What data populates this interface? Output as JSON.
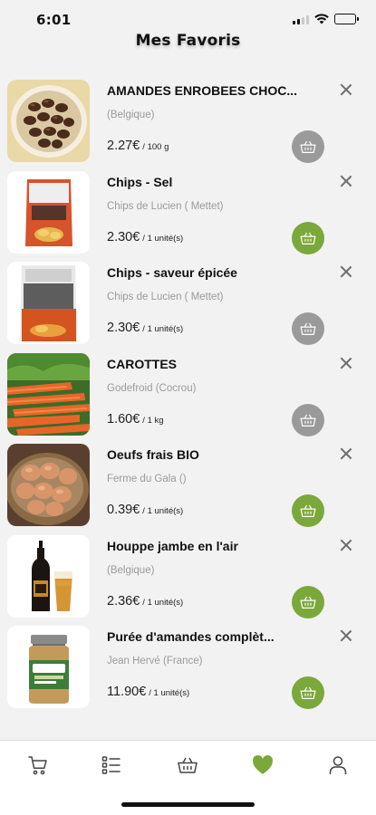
{
  "status_bar": {
    "time": "6:01"
  },
  "header": {
    "title": "Mes Favoris"
  },
  "colors": {
    "accent": "#7ba83a",
    "inactive_button": "#9a9a9a",
    "heart": "#7ba83a"
  },
  "favorites": [
    {
      "name": "AMANDES ENROBEES CHOC...",
      "origin": "(Belgique)",
      "price": "2.27€",
      "unit": "/ 100 g",
      "in_stock": false,
      "image": "chocolate-almonds"
    },
    {
      "name": "Chips - Sel",
      "origin": "Chips de Lucien ( Mettet)",
      "price": "2.30€",
      "unit": "/ 1 unité(s)",
      "in_stock": true,
      "image": "chips-bag"
    },
    {
      "name": "Chips - saveur épicée",
      "origin": "Chips de Lucien ( Mettet)",
      "price": "2.30€",
      "unit": "/ 1 unité(s)",
      "in_stock": false,
      "image": "chips-bag-spicy"
    },
    {
      "name": "CAROTTES",
      "origin": "Godefroid (Cocrou)",
      "price": "1.60€",
      "unit": "/ 1 kg",
      "in_stock": false,
      "image": "carrots"
    },
    {
      "name": "Oeufs frais BIO",
      "origin": "Ferme du Gala ()",
      "price": "0.39€",
      "unit": "/ 1 unité(s)",
      "in_stock": true,
      "image": "eggs"
    },
    {
      "name": "Houppe jambe en l'air",
      "origin": "(Belgique)",
      "price": "2.36€",
      "unit": "/ 1 unité(s)",
      "in_stock": true,
      "image": "beer"
    },
    {
      "name": "Purée d'amandes complèt...",
      "origin": "Jean Hervé (France)",
      "price": "11.90€",
      "unit": "/ 1 unité(s)",
      "in_stock": true,
      "image": "almond-puree-jar"
    }
  ],
  "tab_bar": {
    "tabs": [
      {
        "icon": "cart-icon",
        "active": false
      },
      {
        "icon": "list-icon",
        "active": false
      },
      {
        "icon": "basket-icon",
        "active": false
      },
      {
        "icon": "heart-icon",
        "active": true
      },
      {
        "icon": "profile-icon",
        "active": false
      }
    ]
  }
}
